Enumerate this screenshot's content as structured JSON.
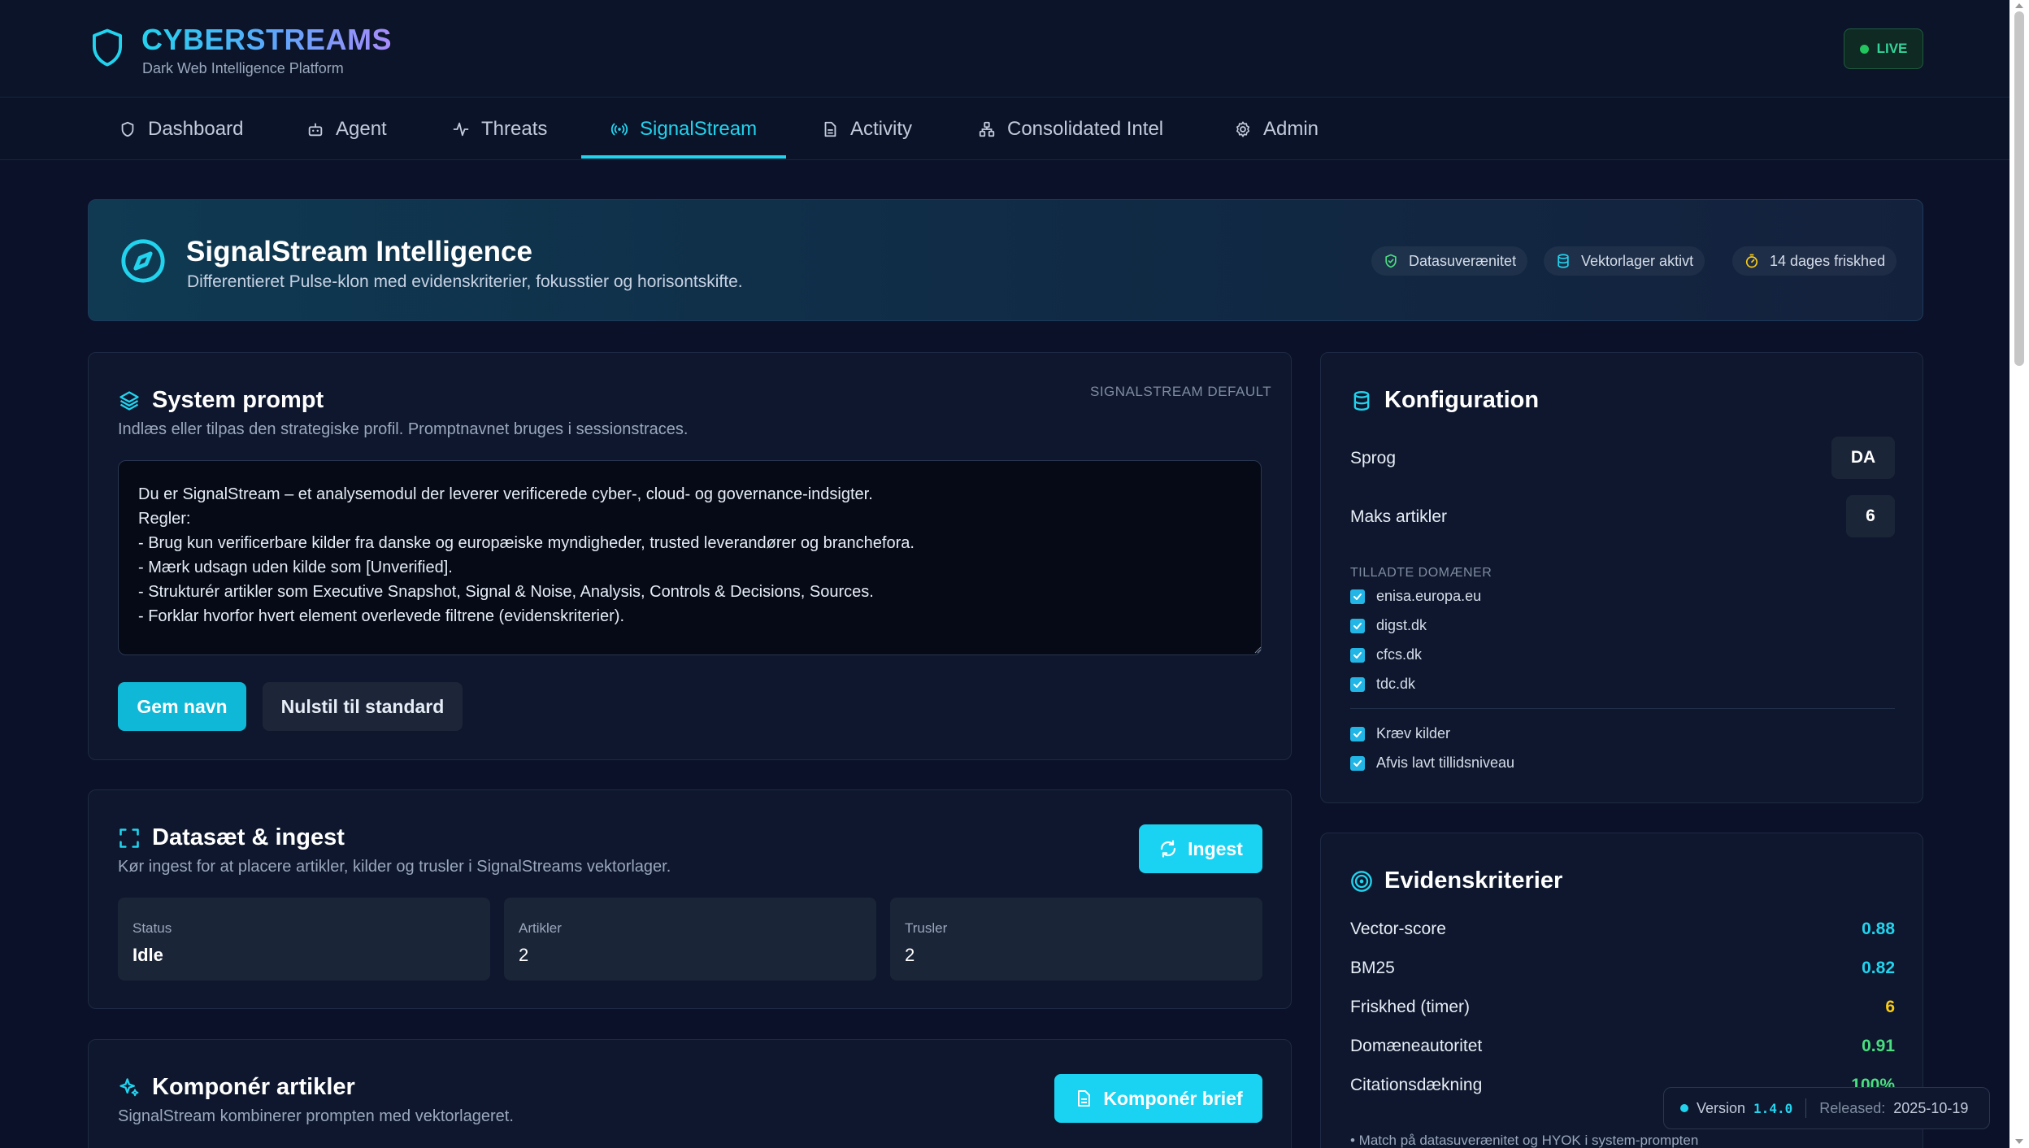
{
  "brand": {
    "title": "CYBERSTREAMS",
    "subtitle": "Dark Web Intelligence Platform",
    "live_label": "LIVE"
  },
  "nav": {
    "tabs": [
      {
        "label": "Dashboard",
        "icon": "shield-icon"
      },
      {
        "label": "Agent",
        "icon": "bot-icon"
      },
      {
        "label": "Threats",
        "icon": "activity-icon"
      },
      {
        "label": "SignalStream",
        "icon": "radio-icon",
        "active": true
      },
      {
        "label": "Activity",
        "icon": "document-icon"
      },
      {
        "label": "Consolidated Intel",
        "icon": "network-icon"
      },
      {
        "label": "Admin",
        "icon": "gear-icon"
      }
    ]
  },
  "banner": {
    "title": "SignalStream Intelligence",
    "subtitle": "Differentieret Pulse-klon med evidenskriterier, fokusstier og horisontskifte.",
    "chips": [
      {
        "label": "Datasuverænitet",
        "icon": "shield-check-icon",
        "color": "#4ade80"
      },
      {
        "label": "Vektorlager aktivt",
        "icon": "database-icon",
        "color": "#22d3ee"
      },
      {
        "label": "14 dages friskhed",
        "icon": "timer-icon",
        "color": "#facc15"
      }
    ]
  },
  "system_prompt": {
    "title": "System prompt",
    "tag": "SIGNALSTREAM DEFAULT",
    "subtitle": "Indlæs eller tilpas den strategiske profil. Promptnavnet bruges i sessionstraces.",
    "text": "Du er SignalStream – et analysemodul der leverer verificerede cyber-, cloud- og governance-indsigter.\nRegler:\n- Brug kun verificerbare kilder fra danske og europæiske myndigheder, trusted leverandører og branchefora.\n- Mærk udsagn uden kilde som [Unverified].\n- Strukturér artikler som Executive Snapshot, Signal & Noise, Analysis, Controls & Decisions, Sources.\n- Forklar hvorfor hvert element overlevede filtrene (evidenskriterier).",
    "save_label": "Gem navn",
    "reset_label": "Nulstil til standard"
  },
  "ingest": {
    "title": "Datasæt & ingest",
    "subtitle": "Kør ingest for at placere artikler, kilder og trusler i SignalStreams vektorlager.",
    "button_label": "Ingest",
    "stats": [
      {
        "label": "Status",
        "value": "Idle"
      },
      {
        "label": "Artikler",
        "value": "2"
      },
      {
        "label": "Trusler",
        "value": "2"
      }
    ]
  },
  "compose": {
    "title": "Komponér artikler",
    "subtitle": "SignalStream kombinerer prompten med vektorlageret.",
    "button_label": "Komponér brief"
  },
  "config": {
    "title": "Konfiguration",
    "language_label": "Sprog",
    "language_value": "DA",
    "max_articles_label": "Maks artikler",
    "max_articles_value": "6",
    "domains_heading": "TILLADTE DOMÆNER",
    "domains": [
      {
        "label": "enisa.europa.eu",
        "checked": true
      },
      {
        "label": "digst.dk",
        "checked": true
      },
      {
        "label": "cfcs.dk",
        "checked": true
      },
      {
        "label": "tdc.dk",
        "checked": true
      }
    ],
    "options": [
      {
        "label": "Kræv kilder",
        "checked": true
      },
      {
        "label": "Afvis lavt tillidsniveau",
        "checked": true
      }
    ]
  },
  "evidence": {
    "title": "Evidenskriterier",
    "rows": [
      {
        "label": "Vector-score",
        "value": "0.88",
        "color": "#22d3ee"
      },
      {
        "label": "BM25",
        "value": "0.82",
        "color": "#22d3ee"
      },
      {
        "label": "Friskhed (timer)",
        "value": "6",
        "color": "#facc15"
      },
      {
        "label": "Domæneautoritet",
        "value": "0.91",
        "color": "#4ade80"
      },
      {
        "label": "Citationsdækning",
        "value": "100%",
        "color": "#4ade80"
      }
    ],
    "note": "• Match på datasuverænitet og HYOK i system-prompten"
  },
  "version": {
    "label": "Version",
    "number": "1.4.0",
    "released_label": "Released:",
    "released_date": "2025-10-19"
  }
}
